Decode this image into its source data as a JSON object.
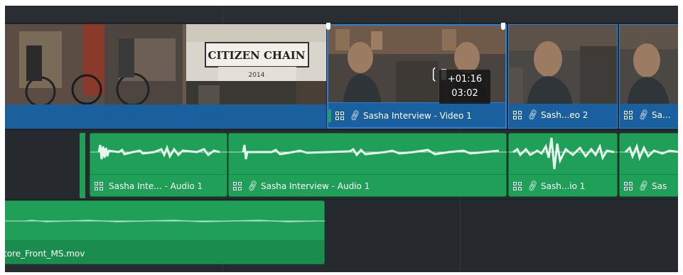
{
  "tooltip": {
    "offset": "+01:16",
    "duration": "03:02"
  },
  "video_clips": [
    {
      "label": ""
    },
    {
      "label": "Sasha Interview - Video 1"
    },
    {
      "label": "Sash...eo 2"
    },
    {
      "label": "Sa..."
    }
  ],
  "audio_clips": [
    {
      "label": "Sasha Inte... - Audio 1"
    },
    {
      "label": "Sasha Interview - Audio 1"
    },
    {
      "label": "Sash...io 1"
    },
    {
      "label": "Sas"
    }
  ],
  "bottom_clip": {
    "label": "tore_Front_MS.mov"
  },
  "thumb_text": {
    "sign": "CITIZEN CHAIN",
    "year": "2014"
  },
  "colors": {
    "video_bar": "#1a5f9e",
    "audio": "#1f9f57",
    "selected_border": "#2e7fd0",
    "bg": "#26292d"
  }
}
